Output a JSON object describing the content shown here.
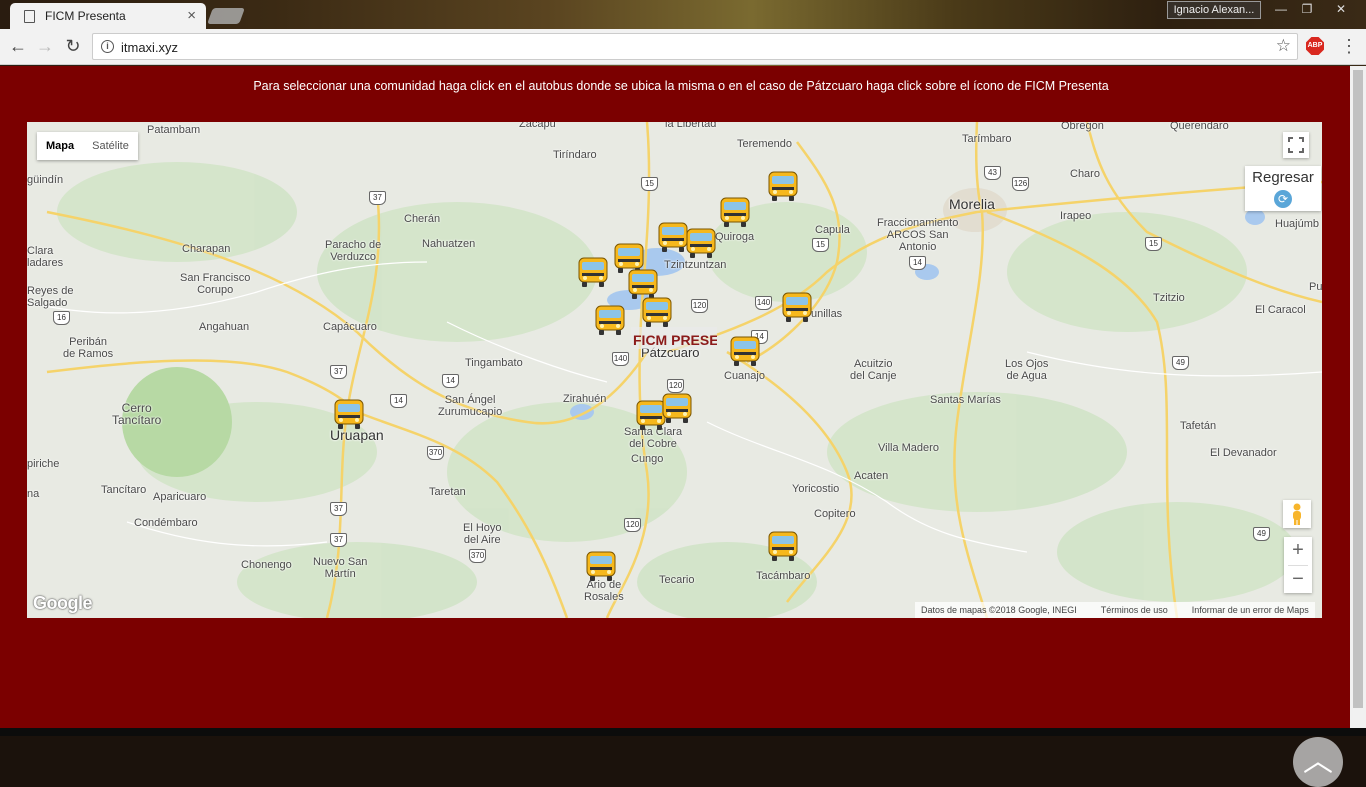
{
  "browser": {
    "tab_title": "FICM Presenta",
    "tab_close": "×",
    "user_name": "Ignacio Alexan...",
    "url": "itmaxi.xyz",
    "minimize": "—",
    "restore": "❐",
    "close": "✕",
    "abp": "ABP"
  },
  "page": {
    "instruction": "Para seleccionar una comunidad haga click en el autobus donde se ubica la misma o en el caso de Pátzcuaro haga click sobre el ícono de FICM Presenta"
  },
  "map": {
    "type_controls": {
      "map": "Mapa",
      "satellite": "Satélite"
    },
    "regresar": "Regresar",
    "zoom_in": "+",
    "zoom_out": "−",
    "google": "Google",
    "attribution": {
      "data": "Datos de mapas ©2018 Google, INEGI",
      "terms": "Términos de uso",
      "report": "Informar de un error de Maps"
    },
    "places": {
      "patambam": "Patambam",
      "zacapu": "Zacapu",
      "la_libertad": "la Libertad",
      "teremendo": "Teremendo",
      "tarimbaro": "Tarímbaro",
      "obregon": "Obregon",
      "querendaro": "Querendaro",
      "tiringaro": "Tiríndaro",
      "guindin": "güindín",
      "cheran": "Cherán",
      "quiroga": "Quiroga",
      "morelia": "Morelia",
      "charo": "Charo",
      "clara_ladares": "Clara\nladares",
      "charapan": "Charapan",
      "paracho": "Paracho de\nVerduzco",
      "nahuatzen": "Nahuatzen",
      "tzintzuntzan": "Tzintzuntzan",
      "capula": "Capula",
      "fraccionamiento": "Fraccionamiento\nARCOS San\nAntonio",
      "irapeo": "Irapeo",
      "huajumb": "Huajúmb",
      "reyes": "Reyes de\nSalgado",
      "san_francisco": "San Francisco\nCorupo",
      "tzitzio": "Tzitzio",
      "pu": "Pu",
      "angahuan": "Angahuan",
      "capacuaro": "Capácuaro",
      "tupatarillas": "unillas",
      "el_caracol": "El Caracol",
      "periban": "Peribán\nde Ramos",
      "tingambato": "Tingambato",
      "patzcuaro": "Pátzcuaro",
      "cuanajo": "Cuanajo",
      "acuitzio": "Acuitzio\ndel Canje",
      "ojos_agua": "Los Ojos\nde Agua",
      "cerro": "Cerro\nTancítaro",
      "san_angel": "San Ángel\nZurumucapio",
      "zirahuen": "Zirahuén",
      "santas_marias": "Santas Marías",
      "uruapan": "Uruapan",
      "santa_clara": "Santa Clara\ndel Cobre",
      "tafetan": "Tafetán",
      "pirichie": "piriche",
      "na": "na",
      "cungo": "Cungo",
      "villa_madero": "Villa Madero",
      "el_devanador": "El Devanador",
      "tancitaro": "Tancítaro",
      "aparicuaro": "Aparicuaro",
      "taretan": "Taretan",
      "acaten": "Acaten",
      "yoricostio": "Yoricostio",
      "condembaro": "Condémbaro",
      "el_hoyo": "El Hoyo\ndel Aire",
      "copitero": "Copitero",
      "chonengo": "Chonengo",
      "nuevo_san_martin": "Nuevo San\nMartín",
      "ario": "Ario de\nRosales",
      "tecario": "Tecario",
      "tacambaro": "Tacámbaro",
      "de": "de"
    },
    "route_shields": [
      "15",
      "37",
      "43",
      "126",
      "15",
      "15",
      "14",
      "120",
      "140",
      "14",
      "16",
      "37",
      "14",
      "140",
      "120",
      "370",
      "49",
      "37",
      "120",
      "37",
      "370",
      "49",
      "14"
    ],
    "logo_text": "FICM PRESENTA"
  }
}
